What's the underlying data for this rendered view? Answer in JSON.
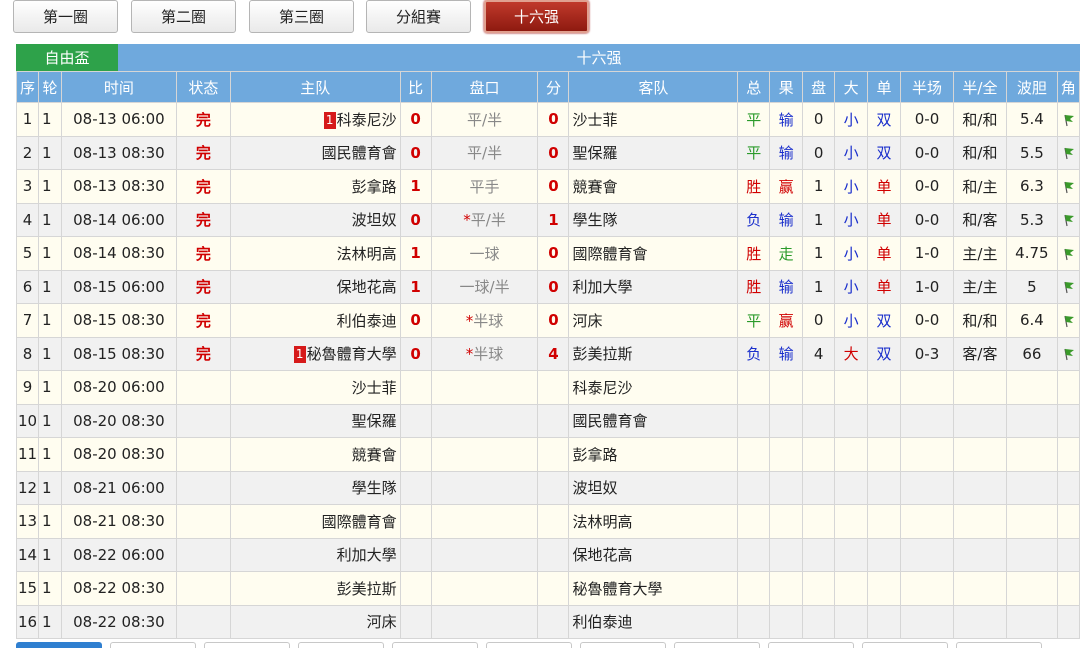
{
  "tabs": [
    {
      "label": "第一圈",
      "active": false
    },
    {
      "label": "第二圈",
      "active": false
    },
    {
      "label": "第三圈",
      "active": false
    },
    {
      "label": "分組賽",
      "active": false
    },
    {
      "label": "十六强",
      "active": true
    }
  ],
  "cup_name": "自由盃",
  "round_name": "十六强",
  "headers": [
    "序",
    "轮",
    "时间",
    "状态",
    "主队",
    "比",
    "盘口",
    "分",
    "客队",
    "总",
    "果",
    "盘",
    "大",
    "单",
    "半场",
    "半/全",
    "波胆",
    "角"
  ],
  "matches": [
    {
      "no": "1",
      "round": "1",
      "time": "08-13 06:00",
      "status": "完",
      "home": "科泰尼沙",
      "home_badge": "1",
      "hs": "0",
      "line": "平/半",
      "line_star": false,
      "as": "0",
      "away": "沙士菲",
      "away_badge": "",
      "total": "平",
      "total_c": "draw",
      "res": "输",
      "res_c": "lose",
      "pan": "0",
      "big": "小",
      "big_c": "lose",
      "odd": "双",
      "odd_c": "lose",
      "half": "0-0",
      "hf": "和/和",
      "cs": "5.4",
      "flag": true
    },
    {
      "no": "2",
      "round": "1",
      "time": "08-13 08:30",
      "status": "完",
      "home": "國民體育會",
      "home_badge": "",
      "hs": "0",
      "line": "平/半",
      "line_star": false,
      "as": "0",
      "away": "聖保羅",
      "away_badge": "",
      "total": "平",
      "total_c": "draw",
      "res": "输",
      "res_c": "lose",
      "pan": "0",
      "big": "小",
      "big_c": "lose",
      "odd": "双",
      "odd_c": "lose",
      "half": "0-0",
      "hf": "和/和",
      "cs": "5.5",
      "flag": true
    },
    {
      "no": "3",
      "round": "1",
      "time": "08-13 08:30",
      "status": "完",
      "home": "彭拿路",
      "home_badge": "",
      "hs": "1",
      "line": "平手",
      "line_star": false,
      "as": "0",
      "away": "競賽會",
      "away_badge": "",
      "total": "胜",
      "total_c": "win",
      "res": "赢",
      "res_c": "win",
      "pan": "1",
      "big": "小",
      "big_c": "lose",
      "odd": "单",
      "odd_c": "win",
      "half": "0-0",
      "hf": "和/主",
      "cs": "6.3",
      "flag": true
    },
    {
      "no": "4",
      "round": "1",
      "time": "08-14 06:00",
      "status": "完",
      "home": "波坦奴",
      "home_badge": "",
      "hs": "0",
      "line": "平/半",
      "line_star": true,
      "as": "1",
      "away": "學生隊",
      "away_badge": "",
      "total": "负",
      "total_c": "lose",
      "res": "输",
      "res_c": "lose",
      "pan": "1",
      "big": "小",
      "big_c": "lose",
      "odd": "单",
      "odd_c": "win",
      "half": "0-0",
      "hf": "和/客",
      "cs": "5.3",
      "flag": true
    },
    {
      "no": "5",
      "round": "1",
      "time": "08-14 08:30",
      "status": "完",
      "home": "法林明高",
      "home_badge": "",
      "hs": "1",
      "line": "一球",
      "line_star": false,
      "as": "0",
      "away": "國際體育會",
      "away_badge": "",
      "total": "胜",
      "total_c": "win",
      "res": "走",
      "res_c": "draw",
      "pan": "1",
      "big": "小",
      "big_c": "lose",
      "odd": "单",
      "odd_c": "win",
      "half": "1-0",
      "hf": "主/主",
      "cs": "4.75",
      "flag": true
    },
    {
      "no": "6",
      "round": "1",
      "time": "08-15 06:00",
      "status": "完",
      "home": "保地花高",
      "home_badge": "",
      "hs": "1",
      "line": "一球/半",
      "line_star": false,
      "as": "0",
      "away": "利加大學",
      "away_badge": "",
      "total": "胜",
      "total_c": "win",
      "res": "输",
      "res_c": "lose",
      "pan": "1",
      "big": "小",
      "big_c": "lose",
      "odd": "单",
      "odd_c": "win",
      "half": "1-0",
      "hf": "主/主",
      "cs": "5",
      "flag": true
    },
    {
      "no": "7",
      "round": "1",
      "time": "08-15 08:30",
      "status": "完",
      "home": "利伯泰迪",
      "home_badge": "",
      "hs": "0",
      "line": "半球",
      "line_star": true,
      "as": "0",
      "away": "河床",
      "away_badge": "",
      "total": "平",
      "total_c": "draw",
      "res": "赢",
      "res_c": "win",
      "pan": "0",
      "big": "小",
      "big_c": "lose",
      "odd": "双",
      "odd_c": "lose",
      "half": "0-0",
      "hf": "和/和",
      "cs": "6.4",
      "flag": true
    },
    {
      "no": "8",
      "round": "1",
      "time": "08-15 08:30",
      "status": "完",
      "home": "秘魯體育大學",
      "home_badge": "1",
      "hs": "0",
      "line": "半球",
      "line_star": true,
      "as": "4",
      "away": "彭美拉斯",
      "away_badge": "",
      "total": "负",
      "total_c": "lose",
      "res": "输",
      "res_c": "lose",
      "pan": "4",
      "big": "大",
      "big_c": "win",
      "odd": "双",
      "odd_c": "lose",
      "half": "0-3",
      "hf": "客/客",
      "cs": "66",
      "flag": true
    },
    {
      "no": "9",
      "round": "1",
      "time": "08-20 06:00",
      "status": "",
      "home": "沙士菲",
      "home_badge": "",
      "hs": "",
      "line": "",
      "line_star": false,
      "as": "",
      "away": "科泰尼沙",
      "away_badge": "",
      "total": "",
      "total_c": "",
      "res": "",
      "res_c": "",
      "pan": "",
      "big": "",
      "big_c": "",
      "odd": "",
      "odd_c": "",
      "half": "",
      "hf": "",
      "cs": "",
      "flag": false
    },
    {
      "no": "10",
      "round": "1",
      "time": "08-20 08:30",
      "status": "",
      "home": "聖保羅",
      "home_badge": "",
      "hs": "",
      "line": "",
      "line_star": false,
      "as": "",
      "away": "國民體育會",
      "away_badge": "",
      "total": "",
      "total_c": "",
      "res": "",
      "res_c": "",
      "pan": "",
      "big": "",
      "big_c": "",
      "odd": "",
      "odd_c": "",
      "half": "",
      "hf": "",
      "cs": "",
      "flag": false
    },
    {
      "no": "11",
      "round": "1",
      "time": "08-20 08:30",
      "status": "",
      "home": "競賽會",
      "home_badge": "",
      "hs": "",
      "line": "",
      "line_star": false,
      "as": "",
      "away": "彭拿路",
      "away_badge": "",
      "total": "",
      "total_c": "",
      "res": "",
      "res_c": "",
      "pan": "",
      "big": "",
      "big_c": "",
      "odd": "",
      "odd_c": "",
      "half": "",
      "hf": "",
      "cs": "",
      "flag": false
    },
    {
      "no": "12",
      "round": "1",
      "time": "08-21 06:00",
      "status": "",
      "home": "學生隊",
      "home_badge": "",
      "hs": "",
      "line": "",
      "line_star": false,
      "as": "",
      "away": "波坦奴",
      "away_badge": "",
      "total": "",
      "total_c": "",
      "res": "",
      "res_c": "",
      "pan": "",
      "big": "",
      "big_c": "",
      "odd": "",
      "odd_c": "",
      "half": "",
      "hf": "",
      "cs": "",
      "flag": false
    },
    {
      "no": "13",
      "round": "1",
      "time": "08-21 08:30",
      "status": "",
      "home": "國際體育會",
      "home_badge": "",
      "hs": "",
      "line": "",
      "line_star": false,
      "as": "",
      "away": "法林明高",
      "away_badge": "",
      "total": "",
      "total_c": "",
      "res": "",
      "res_c": "",
      "pan": "",
      "big": "",
      "big_c": "",
      "odd": "",
      "odd_c": "",
      "half": "",
      "hf": "",
      "cs": "",
      "flag": false
    },
    {
      "no": "14",
      "round": "1",
      "time": "08-22 06:00",
      "status": "",
      "home": "利加大學",
      "home_badge": "",
      "hs": "",
      "line": "",
      "line_star": false,
      "as": "",
      "away": "保地花高",
      "away_badge": "",
      "total": "",
      "total_c": "",
      "res": "",
      "res_c": "",
      "pan": "",
      "big": "",
      "big_c": "",
      "odd": "",
      "odd_c": "",
      "half": "",
      "hf": "",
      "cs": "",
      "flag": false
    },
    {
      "no": "15",
      "round": "1",
      "time": "08-22 08:30",
      "status": "",
      "home": "彭美拉斯",
      "home_badge": "",
      "hs": "",
      "line": "",
      "line_star": false,
      "as": "",
      "away": "秘魯體育大學",
      "away_badge": "",
      "total": "",
      "total_c": "",
      "res": "",
      "res_c": "",
      "pan": "",
      "big": "",
      "big_c": "",
      "odd": "",
      "odd_c": "",
      "half": "",
      "hf": "",
      "cs": "",
      "flag": false
    },
    {
      "no": "16",
      "round": "1",
      "time": "08-22 08:30",
      "status": "",
      "home": "河床",
      "home_badge": "",
      "hs": "",
      "line": "",
      "line_star": false,
      "as": "",
      "away": "利伯泰迪",
      "away_badge": "",
      "total": "",
      "total_c": "",
      "res": "",
      "res_c": "",
      "pan": "",
      "big": "",
      "big_c": "",
      "odd": "",
      "odd_c": "",
      "half": "",
      "hf": "",
      "cs": "",
      "flag": false
    }
  ],
  "colors": {
    "header_blue": "#6fa9dd",
    "cup_green": "#2ea24a",
    "active_tab_red": "#a8231a",
    "score_red": "#d00000",
    "lose_blue": "#1a2fcc",
    "draw_green": "#2a9a2a",
    "flag_green": "#3a9a2a"
  }
}
